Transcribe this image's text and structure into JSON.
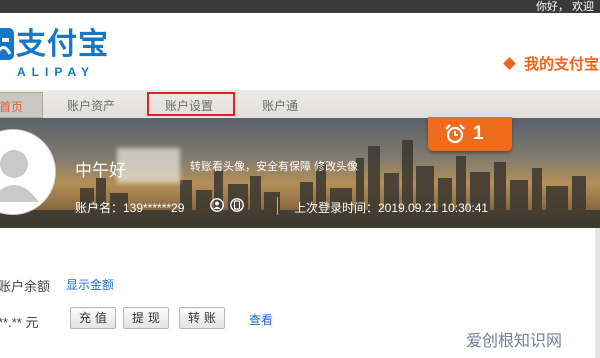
{
  "topbar": {
    "greeting": "你好，  欢迎"
  },
  "header": {
    "logo_cn": "支付宝",
    "logo_en": "ALIPAY",
    "logo_icon": "alipay-logo-icon",
    "my_alipay": "我的支付宝"
  },
  "nav": {
    "items": [
      {
        "label": "首页",
        "active": true
      },
      {
        "label": "账户资产"
      },
      {
        "label": "账户设置",
        "highlighted": true
      },
      {
        "label": "账户通"
      }
    ]
  },
  "profile": {
    "name": "中午好",
    "tip": "转账看头像，安全有保障 修改头像",
    "account": "账户名：139******29",
    "last_login": "上次登录时间：2019.09.21 10:30:41",
    "alarm_count": "1",
    "icons": [
      "user-avatar-icon",
      "id-verify-icon",
      "phone-bind-icon",
      "alarm-clock-icon"
    ]
  },
  "balance": {
    "label": "账户余额",
    "show_link": "显示金额",
    "amount": "**.** 元",
    "buttons": [
      "充 值",
      "提 现",
      "转 账"
    ],
    "view_link": "查看"
  },
  "watermark": "爱创根知识网",
  "colors": {
    "brand_blue": "#1677c9",
    "accent_orange": "#f0641e",
    "highlight_red": "#e0202a",
    "link_blue": "#1b6fc4"
  }
}
